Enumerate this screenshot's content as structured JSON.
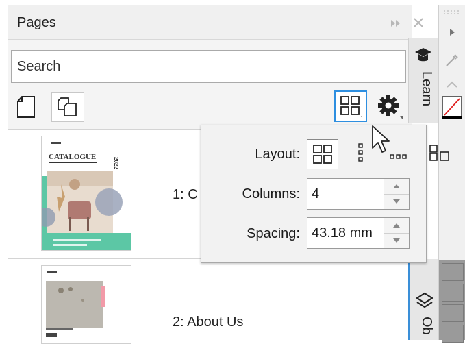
{
  "panel": {
    "title": "Pages",
    "search_placeholder": "Search",
    "toolbar_icons": [
      "new-page-icon",
      "duplicate-page-icon",
      "layout-view-icon",
      "settings-gear-icon"
    ],
    "header_icons": [
      "expand-arrows-icon",
      "close-icon"
    ]
  },
  "pages": [
    {
      "label": "1: C",
      "thumbnail": {
        "heading": "CATALOGUE",
        "year": "2022"
      }
    },
    {
      "label": "2: About Us"
    }
  ],
  "side_tabs": {
    "learn": "Learn",
    "objects": "Ob"
  },
  "flyout": {
    "layout_label": "Layout:",
    "columns_label": "Columns:",
    "columns_value": "4",
    "spacing_label": "Spacing:",
    "spacing_value": "43.18 mm",
    "layout_options": [
      "grid-layout-icon",
      "vertical-layout-icon",
      "horizontal-layout-icon"
    ]
  },
  "colors": {
    "accent": "#2e8fe0",
    "panel_bg": "#f4f4f4",
    "teal": "#5cc7a5",
    "no_color_red": "#e02020"
  }
}
